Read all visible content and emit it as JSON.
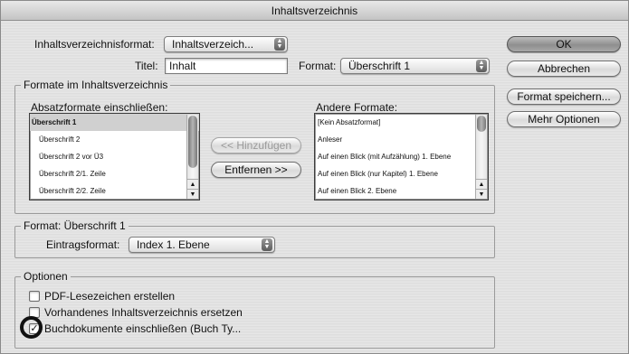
{
  "window": {
    "title": "Inhaltsverzeichnis"
  },
  "top": {
    "format_label": "Inhaltsverzeichnisformat:",
    "format_value": "Inhaltsverzeich...",
    "titel_label": "Titel:",
    "titel_value": "Inhalt",
    "format2_label": "Format:",
    "format2_value": "Überschrift 1"
  },
  "buttons": {
    "ok": "OK",
    "abbrechen": "Abbrechen",
    "format_speichern": "Format speichern...",
    "mehr_optionen": "Mehr Optionen"
  },
  "formate": {
    "group_title": "Formate im Inhaltsverzeichnis",
    "include_label": "Absatzformate einschließen:",
    "included": [
      "Überschrift 1",
      "Überschrift 2",
      "Überschrift 2 vor Ü3",
      "Überschrift 2/1. Zeile",
      "Überschrift 2/2. Zeile"
    ],
    "hinzufuegen": "<< Hinzufügen",
    "entfernen": "Entfernen >>",
    "andere_label": "Andere Formate:",
    "andere": [
      "[Kein Absatzformat]",
      "Anleser",
      "Auf einen Blick (mit Aufzählung) 1. Ebene",
      "Auf einen Blick (nur Kapitel) 1. Ebene",
      "Auf einen Blick 2. Ebene"
    ]
  },
  "format_section": {
    "group_title": "Format: Überschrift 1",
    "eintrag_label": "Eintragsformat:",
    "eintrag_value": "Index 1. Ebene"
  },
  "optionen": {
    "group_title": "Optionen",
    "pdf": "PDF-Lesezeichen erstellen",
    "ersetzen": "Vorhandenes Inhaltsverzeichnis ersetzen",
    "buch": "Buchdokumente einschließen",
    "buch_suffix": "(Buch Ty..."
  }
}
